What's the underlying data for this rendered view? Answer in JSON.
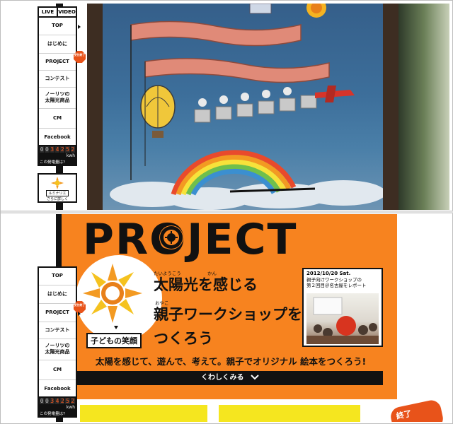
{
  "sidenav": {
    "live": "LIVE",
    "video": "VIDEO",
    "items": [
      {
        "label": "TOP"
      },
      {
        "label": "はじめに"
      },
      {
        "label": "PROJECT",
        "badge": "受付終了"
      },
      {
        "label": "コンテスト"
      },
      {
        "label": "ノーリツの\n太陽光商品"
      },
      {
        "label": "CM"
      },
      {
        "label": "Facebook"
      }
    ]
  },
  "counter": {
    "digits": [
      "0",
      "0",
      "3",
      "4",
      "2",
      "5",
      "2"
    ],
    "unit": "kwh",
    "link": "この発電量は?"
  },
  "lumi": {
    "name": "ルミナリエ",
    "more": "さらに詳しく"
  },
  "project": {
    "title": "PROJECT",
    "badge": "子どもの笑顔",
    "lines": [
      "太陽光を感じる",
      "親子ワークショップを",
      "つくろう"
    ],
    "ruby": {
      "taiyoukou": "たいようこう",
      "kan": "かん",
      "oyako": "おやこ"
    },
    "subtitle": "太陽を感じて、遊んで、考えて。親子でオリジナル 絵本をつくろう!",
    "more_button": "くわしくみる",
    "news": {
      "date": "2012/10/20 Sat.",
      "title": "親子向けワークショップの\n第２回目＠名古屋をレポート"
    },
    "peek_text": "終了"
  },
  "colors": {
    "accent_orange": "#f7831f",
    "digit_red": "#ff5a1f",
    "badge_red": "#e8531a"
  }
}
